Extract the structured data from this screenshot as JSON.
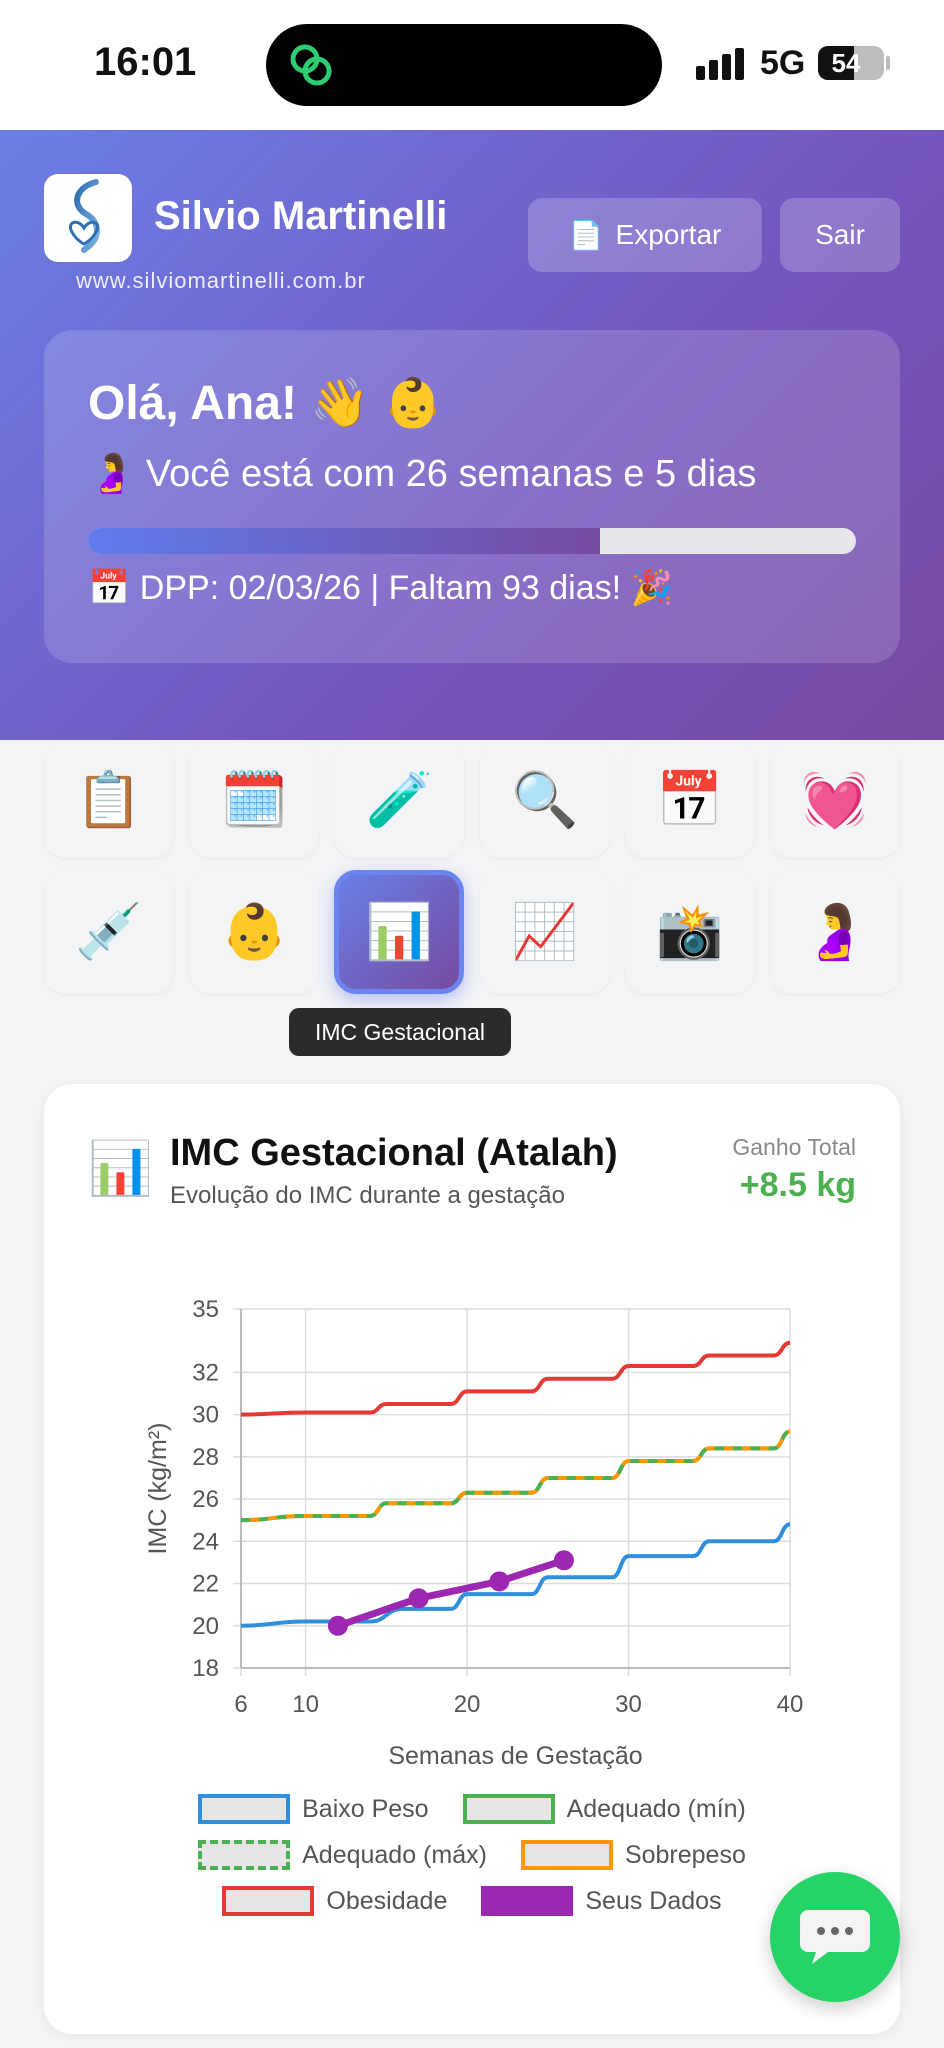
{
  "status": {
    "time": "16:01",
    "network": "5G",
    "battery": "54",
    "battery_level": 0.54
  },
  "header": {
    "brand": "Silvio Martinelli",
    "url": "www.silviomartinelli.com.br",
    "export_label": "Exportar",
    "export_icon": "📄",
    "logout_label": "Sair"
  },
  "greeting": {
    "title": "Olá, Ana! 👋 👶",
    "weeks": "🤰 Você está com 26 semanas e 5 dias",
    "progress": 0.667,
    "dpp": "📅 DPP: 02/03/26 | Faltam 93 dias! 🎉"
  },
  "tiles": [
    {
      "icon": "📋",
      "name": "clipboard"
    },
    {
      "icon": "🗓️",
      "name": "spiral-calendar"
    },
    {
      "icon": "🧪",
      "name": "test-tube"
    },
    {
      "icon": "🔍",
      "name": "magnifier"
    },
    {
      "icon": "📅",
      "name": "calendar"
    },
    {
      "icon": "💓",
      "name": "heart"
    },
    {
      "icon": "💉",
      "name": "syringe"
    },
    {
      "icon": "👶",
      "name": "baby"
    },
    {
      "icon": "📊",
      "name": "bar-chart",
      "active": true
    },
    {
      "icon": "📈",
      "name": "trend-chart"
    },
    {
      "icon": "📸",
      "name": "camera"
    },
    {
      "icon": "🤰",
      "name": "pregnant"
    }
  ],
  "tooltip": "IMC Gestacional",
  "card": {
    "icon": "📊",
    "title": "IMC Gestacional (Atalah)",
    "subtitle": "Evolução do IMC durante a gestação",
    "gain_label": "Ganho Total",
    "gain_value": "+8.5 kg"
  },
  "chart_data": {
    "type": "line",
    "xlabel": "Semanas de Gestação",
    "ylabel": "IMC (kg/m²)",
    "xlim": [
      6,
      40
    ],
    "ylim": [
      18,
      35
    ],
    "x_ticks": [
      "6",
      "10",
      "20",
      "30",
      "40"
    ],
    "y_ticks": [
      "18",
      "20",
      "22",
      "24",
      "26",
      "28",
      "30",
      "32",
      "35"
    ],
    "grid": true,
    "legend_position": "bottom",
    "series": [
      {
        "name": "Baixo Peso",
        "color": "#2f8fdc",
        "style": "solid",
        "x": [
          6,
          10,
          14,
          16,
          19,
          20,
          24,
          25,
          29,
          30,
          34,
          35,
          39,
          40
        ],
        "y": [
          20.0,
          20.2,
          20.2,
          20.8,
          20.8,
          21.5,
          21.5,
          22.3,
          22.3,
          23.3,
          23.3,
          24.0,
          24.0,
          24.8
        ]
      },
      {
        "name": "Adequado (mín)",
        "color": "#4caf50",
        "style": "solid",
        "x": [
          6,
          10,
          14,
          15,
          19,
          20,
          24,
          25,
          29,
          30,
          34,
          35,
          39,
          40
        ],
        "y": [
          25.0,
          25.2,
          25.2,
          25.8,
          25.8,
          26.3,
          26.3,
          27.0,
          27.0,
          27.8,
          27.8,
          28.4,
          28.4,
          29.2
        ]
      },
      {
        "name": "Adequado (máx)",
        "color": "#4caf50",
        "style": "dashed",
        "x": [
          6,
          10,
          14,
          15,
          19,
          20,
          24,
          25,
          29,
          30,
          34,
          35,
          39,
          40
        ],
        "y": [
          25.0,
          25.2,
          25.2,
          25.8,
          25.8,
          26.3,
          26.3,
          27.0,
          27.0,
          27.8,
          27.8,
          28.4,
          28.4,
          29.2
        ]
      },
      {
        "name": "Sobrepeso",
        "color": "#ff9800",
        "style": "dashed-offset",
        "x": [
          6,
          10,
          14,
          15,
          19,
          20,
          24,
          25,
          29,
          30,
          34,
          35,
          39,
          40
        ],
        "y": [
          25.0,
          25.2,
          25.2,
          25.8,
          25.8,
          26.3,
          26.3,
          27.0,
          27.0,
          27.8,
          27.8,
          28.4,
          28.4,
          29.2
        ]
      },
      {
        "name": "Obesidade",
        "color": "#e53935",
        "style": "solid",
        "x": [
          6,
          10,
          14,
          15,
          19,
          20,
          24,
          25,
          29,
          30,
          34,
          35,
          39,
          40
        ],
        "y": [
          30.0,
          30.1,
          30.1,
          30.5,
          30.5,
          31.1,
          31.1,
          31.7,
          31.7,
          32.3,
          32.3,
          32.8,
          32.8,
          33.4
        ]
      },
      {
        "name": "Seus Dados",
        "color": "#9c27b0",
        "style": "points",
        "x": [
          12,
          17,
          22,
          26
        ],
        "y": [
          20.0,
          21.3,
          22.1,
          23.1
        ]
      }
    ]
  }
}
